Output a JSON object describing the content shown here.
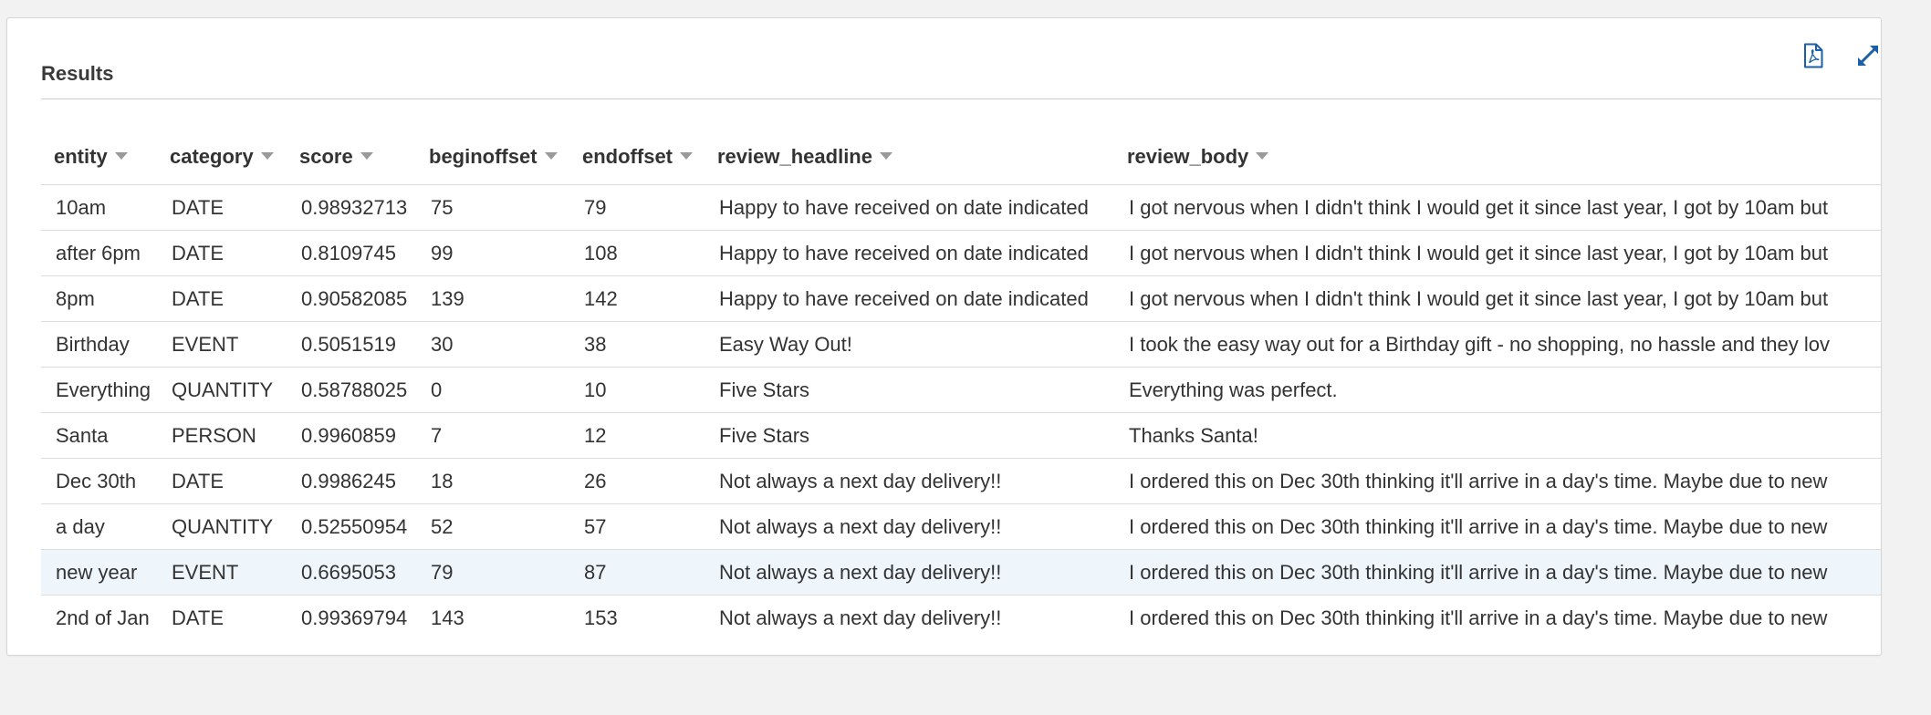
{
  "panel": {
    "title": "Results",
    "icons": {
      "pdf": "pdf-export-icon",
      "expand": "expand-fullscreen-icon"
    },
    "accent_color": "#1a5fa8"
  },
  "table": {
    "columns": [
      "entity",
      "category",
      "score",
      "beginoffset",
      "endoffset",
      "review_headline",
      "review_body"
    ],
    "rows": [
      [
        "10am",
        "DATE",
        "0.98932713",
        "75",
        "79",
        "Happy to have received on date indicated",
        "I got nervous when I didn't think I would get it since last year, I got by 10am but"
      ],
      [
        "after 6pm",
        "DATE",
        "0.8109745",
        "99",
        "108",
        "Happy to have received on date indicated",
        "I got nervous when I didn't think I would get it since last year, I got by 10am but"
      ],
      [
        "8pm",
        "DATE",
        "0.90582085",
        "139",
        "142",
        "Happy to have received on date indicated",
        "I got nervous when I didn't think I would get it since last year, I got by 10am but"
      ],
      [
        "Birthday",
        "EVENT",
        "0.5051519",
        "30",
        "38",
        "Easy Way Out!",
        "I took the easy way out for a Birthday gift - no shopping, no hassle and they lov"
      ],
      [
        "Everything",
        "QUANTITY",
        "0.58788025",
        "0",
        "10",
        "Five Stars",
        "Everything was perfect."
      ],
      [
        "Santa",
        "PERSON",
        "0.9960859",
        "7",
        "12",
        "Five Stars",
        "Thanks Santa!"
      ],
      [
        "Dec 30th",
        "DATE",
        "0.9986245",
        "18",
        "26",
        "Not always a next day delivery!!",
        "I ordered this on Dec 30th thinking it'll arrive in a day's time. Maybe due to new"
      ],
      [
        "a day",
        "QUANTITY",
        "0.52550954",
        "52",
        "57",
        "Not always a next day delivery!!",
        "I ordered this on Dec 30th thinking it'll arrive in a day's time. Maybe due to new"
      ],
      [
        "new year",
        "EVENT",
        "0.6695053",
        "79",
        "87",
        "Not always a next day delivery!!",
        "I ordered this on Dec 30th thinking it'll arrive in a day's time. Maybe due to new"
      ],
      [
        "2nd of Jan",
        "DATE",
        "0.99369794",
        "143",
        "153",
        "Not always a next day delivery!!",
        "I ordered this on Dec 30th thinking it'll arrive in a day's time. Maybe due to new"
      ]
    ],
    "highlighted_row": 8
  }
}
